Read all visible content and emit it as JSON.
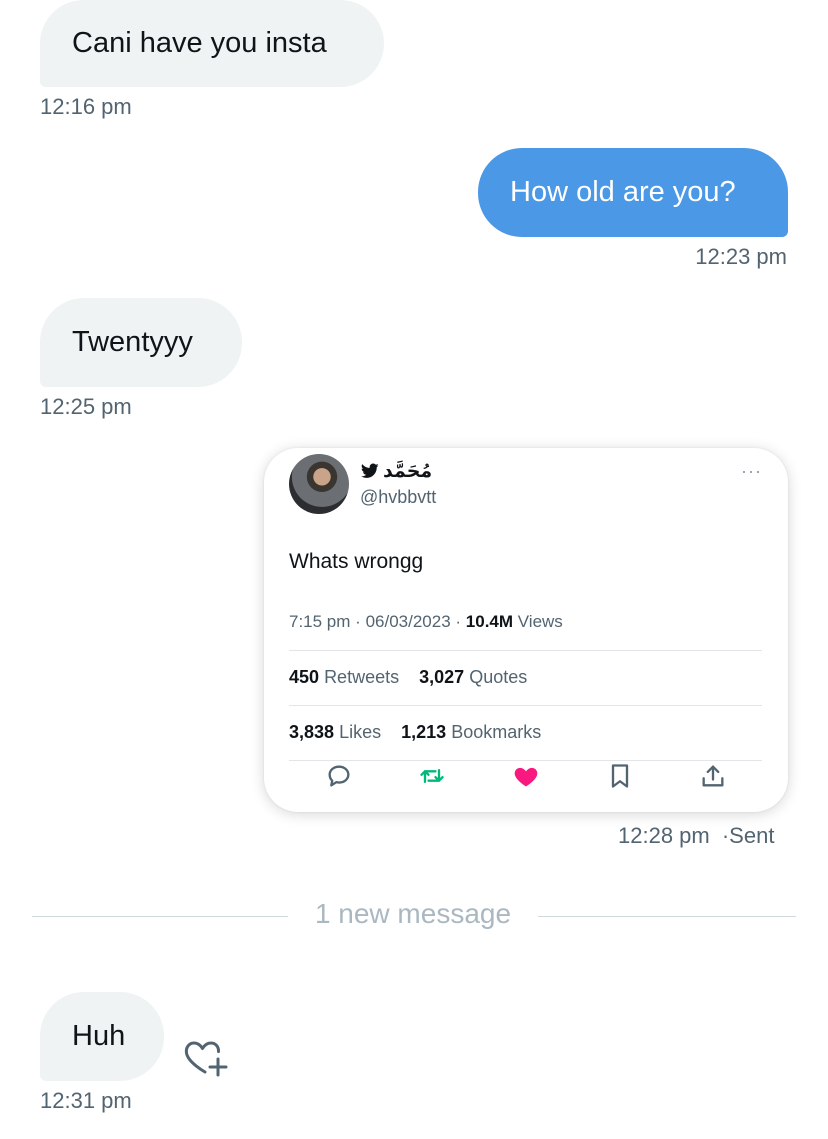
{
  "messages": [
    {
      "text": "Cani have you insta",
      "time": "12:16 pm"
    },
    {
      "text": "How old are you?",
      "time": "12:23 pm"
    },
    {
      "text": "Twentyyy",
      "time": "12:25 pm"
    },
    {
      "text": "Huh",
      "time": "12:31 pm"
    }
  ],
  "tweet": {
    "display_name": "مُحَمَّد",
    "handle": "@hvbbvtt",
    "text": "Whats wrongg",
    "time": "7:15 pm",
    "date": "06/03/2023",
    "views_count": "10.4M",
    "views_label": "Views",
    "retweets_count": "450",
    "retweets_label": "Retweets",
    "quotes_count": "3,027",
    "quotes_label": "Quotes",
    "likes_count": "3,838",
    "likes_label": "Likes",
    "bookmarks_count": "1,213",
    "bookmarks_label": "Bookmarks",
    "more_icon": "···",
    "colors": {
      "retweet": "#00ba7c",
      "like": "#f91880",
      "icon": "#536471"
    }
  },
  "tweet_sent_time": "12:28 pm",
  "sent_status": "·Sent",
  "new_message_divider": "1 new message",
  "colors": {
    "outgoing_bubble": "#4a98e6",
    "incoming_bubble": "#eff3f4",
    "timestamp": "#536471"
  },
  "icons": [
    "twitter-bird-icon",
    "more-icon",
    "reply-icon",
    "retweet-icon",
    "like-icon",
    "bookmark-icon",
    "share-icon",
    "add-reaction-icon"
  ]
}
